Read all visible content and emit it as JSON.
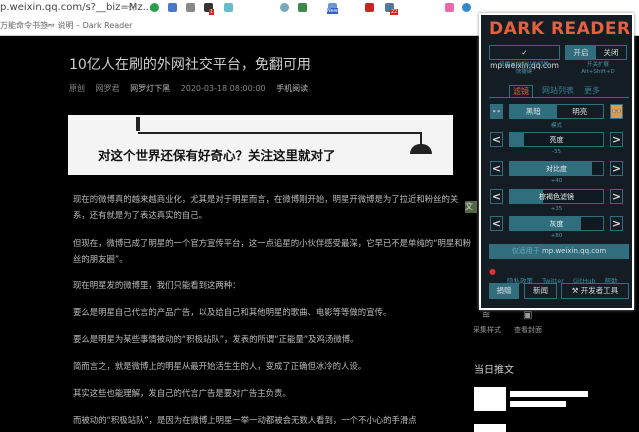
{
  "browser": {
    "url": "p.weixin.qq.com/s?__biz=Mz...",
    "bookmarks": [
      "万能命令书签",
      "说明 – Dark Reader"
    ],
    "extension_badges": [
      "1",
      "New",
      "22"
    ]
  },
  "article": {
    "title": "10亿人在刷的外网社交平台，免翻可用",
    "meta": {
      "tag": "原创",
      "author": "网罗君",
      "account": "网罗灯下黑",
      "date": "2020-03-18 08:00:00",
      "mobile": "手机阅读"
    },
    "banner_text": "对这个世界还保有好奇心？关注这里就对了",
    "paragraphs": [
      "现在的微博真的越来越商业化，尤其是对于明星而言，在微博刚开始，明星开微博是为了拉近和粉丝的关系，还有就是为了表达真实的自己。",
      "但现在，微博已成了明星的一个官方宣传平台，这一点追星的小伙伴感受最深，它早已不是单纯的“明星和粉丝的朋友圈”。",
      "现在明星发的微博里，我们只能看到这两种：",
      "要么是明星自己代言的产品广告，以及给自己和其他明星的歌曲、电影等等做的宣传。",
      "要么是明星为某些事情被动的“积极站队”，发表的所谓“正能量”及鸡汤微博。",
      "简而言之，就是微博上的明星从最开始活生生的人，变成了正确但冰冷的人设。",
      "其实这些也能理解，发自己的代言广告是要对广告主负责。",
      "而被动的“积极站队”，是因为在微博上明星一举一动都被会无数人看到，一个不小心的手滑点"
    ]
  },
  "sidebar": {
    "side_tag": "文",
    "actions": [
      "采集样式",
      "查看封面"
    ],
    "daily_heading": "当日推文"
  },
  "dark_reader": {
    "title": "DARK READER",
    "site": "✓ mp.weixin.qq.com",
    "site_hint": "设置当前网站的切换快捷键",
    "on": "开启",
    "off": "关闭",
    "toggle_hint": "开关扩展 Alt+Shift+D",
    "tabs": [
      "滤镜",
      "网站列表",
      "更多"
    ],
    "active_tab": 0,
    "mode": {
      "dark": "黑暗",
      "light": "明亮",
      "label": "模式",
      "selected": "dark"
    },
    "sliders": [
      {
        "label": "亮度",
        "value": "-35",
        "fill": 0.15
      },
      {
        "label": "对比度",
        "value": "+40",
        "fill": 0.88
      },
      {
        "label": "棕褐色滤镜",
        "value": "+35",
        "fill": 0.35
      },
      {
        "label": "灰度",
        "value": "+80",
        "fill": 0.76
      }
    ],
    "apply_prefix": "仅适用于",
    "apply_site": "mp.weixin.qq.com",
    "links": [
      "隐私政策",
      "Twitter",
      "GitHub",
      "帮助"
    ],
    "buttons": [
      "捐赠",
      "新闻",
      "开发者工具"
    ],
    "colors": {
      "accent": "#e4603f",
      "teal": "#306e7e",
      "bg": "#141d23"
    }
  }
}
